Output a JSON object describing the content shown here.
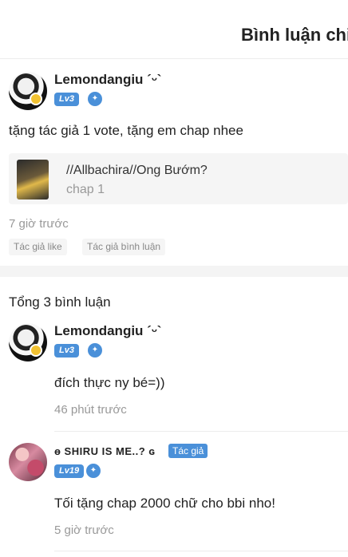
{
  "header": {
    "title": "Bình luận chi"
  },
  "top_comment": {
    "username": "Lemondangiu ´ᵕ`",
    "level": "Lv3",
    "text": "tặng tác giả 1 vote, tặng em chap nhee",
    "chapter": {
      "name": "//Allbachira//Ong Bướm?",
      "chap": "chap 1"
    },
    "time": "7 giờ trước",
    "tags": [
      "Tác giả like",
      "Tác giả bình luận"
    ]
  },
  "replies": {
    "total_label": "Tổng 3 bình luận",
    "items": [
      {
        "username": "Lemondangiu ´ᵕ`",
        "level": "Lv3",
        "text": "đích thực ny bé=))",
        "time": "46 phút trước"
      },
      {
        "username": "ɵ SHIRU IS ME..? ɢ",
        "level": "Lv19",
        "author_tag": "Tác giả",
        "text": "Tối tặng chap 2000 chữ cho bbi nho!",
        "time": "5 giờ trước"
      }
    ]
  }
}
